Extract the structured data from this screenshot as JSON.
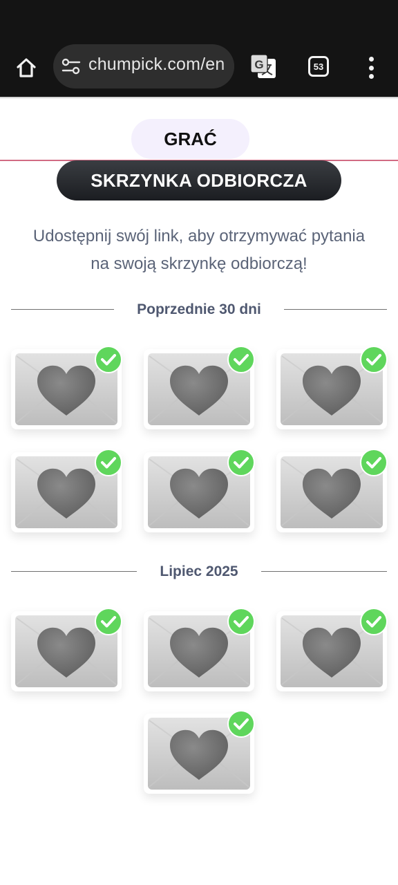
{
  "browser": {
    "url": "chumpick.com/en",
    "tab_count": "53",
    "icons": [
      "home-icon",
      "site-settings-icon",
      "translate-icon",
      "tab-switcher-icon",
      "more-vert-icon"
    ],
    "theme_color": "#141414"
  },
  "page": {
    "play_tab_label": "GRAĆ",
    "inbox_label": "SKRZYNKA ODBIORCZA",
    "subtitle_line1": "Udostępnij swój link, aby otrzymywać pytania",
    "subtitle_line2": "na swoją skrzynkę odbiorczą!",
    "accent_color": "#d16a83",
    "check_color": "#5fd65c"
  },
  "sections": [
    {
      "label": "Poprzednie 30 dni",
      "items": [
        {
          "icon": "heart-envelope-icon",
          "status": "read-check-icon"
        },
        {
          "icon": "heart-envelope-icon",
          "status": "read-check-icon"
        },
        {
          "icon": "heart-envelope-icon",
          "status": "read-check-icon"
        },
        {
          "icon": "heart-envelope-icon",
          "status": "read-check-icon"
        },
        {
          "icon": "heart-envelope-icon",
          "status": "read-check-icon"
        },
        {
          "icon": "heart-envelope-icon",
          "status": "read-check-icon"
        }
      ]
    },
    {
      "label": "Lipiec 2025",
      "items": [
        {
          "icon": "heart-envelope-icon",
          "status": "read-check-icon"
        },
        {
          "icon": "heart-envelope-icon",
          "status": "read-check-icon"
        },
        {
          "icon": "heart-envelope-icon",
          "status": "read-check-icon"
        },
        {
          "icon": "heart-envelope-icon",
          "status": "read-check-icon"
        }
      ]
    }
  ]
}
